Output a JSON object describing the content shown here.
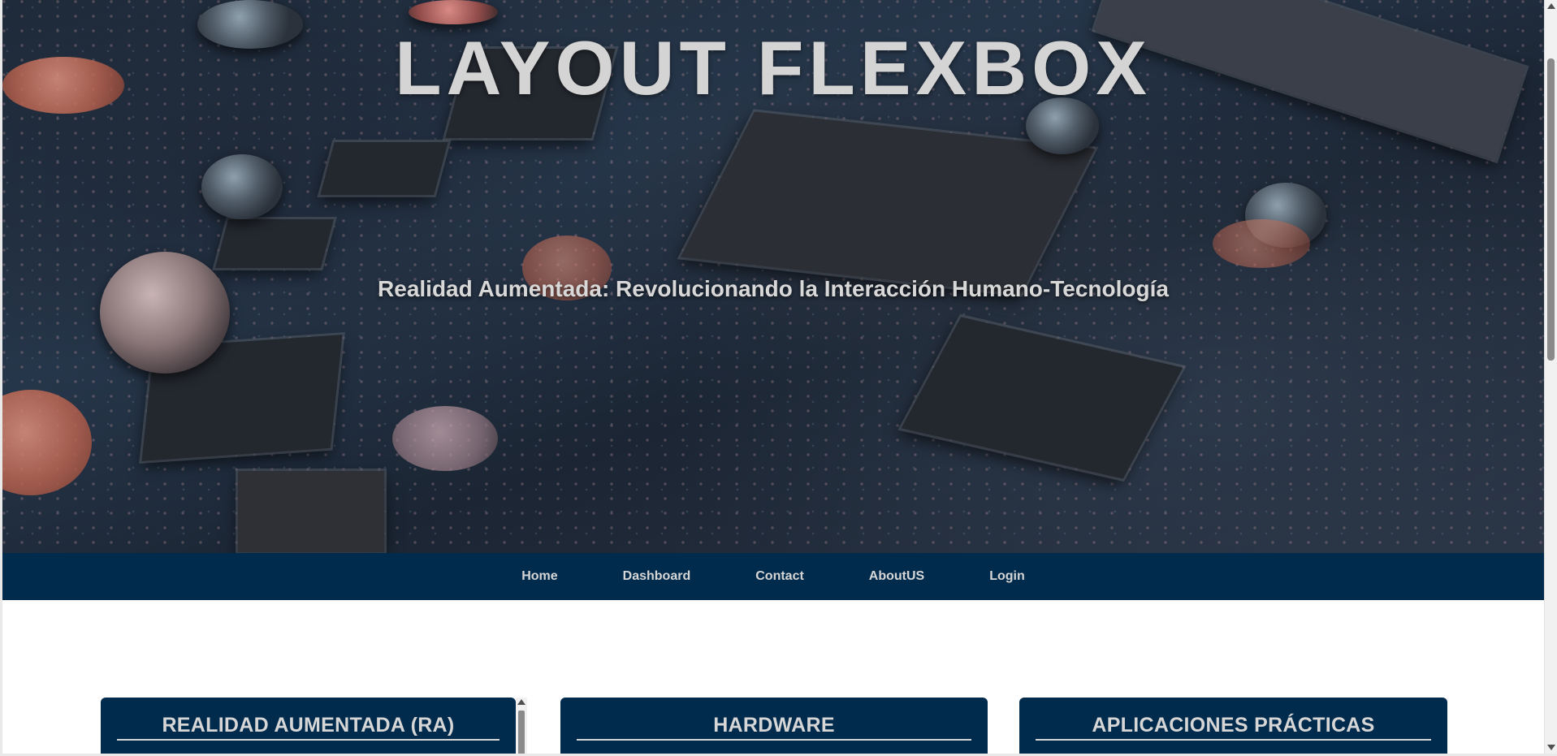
{
  "hero": {
    "title": "LAYOUT FLEXBOX",
    "subtitle": "Realidad Aumentada: Revolucionando la Interacción Humano-Tecnología",
    "background_image": "circuit-board-image"
  },
  "nav": {
    "items": [
      {
        "label": "Home"
      },
      {
        "label": "Dashboard"
      },
      {
        "label": "Contact"
      },
      {
        "label": "AboutUS"
      },
      {
        "label": "Login"
      }
    ]
  },
  "cards": [
    {
      "title": "REALIDAD AUMENTADA (RA)"
    },
    {
      "title": "HARDWARE"
    },
    {
      "title": "APLICACIONES PRÁCTICAS"
    }
  ],
  "colors": {
    "nav_background": "#002b4d",
    "card_background": "#002b4d",
    "text_light": "#d6d6d6"
  }
}
